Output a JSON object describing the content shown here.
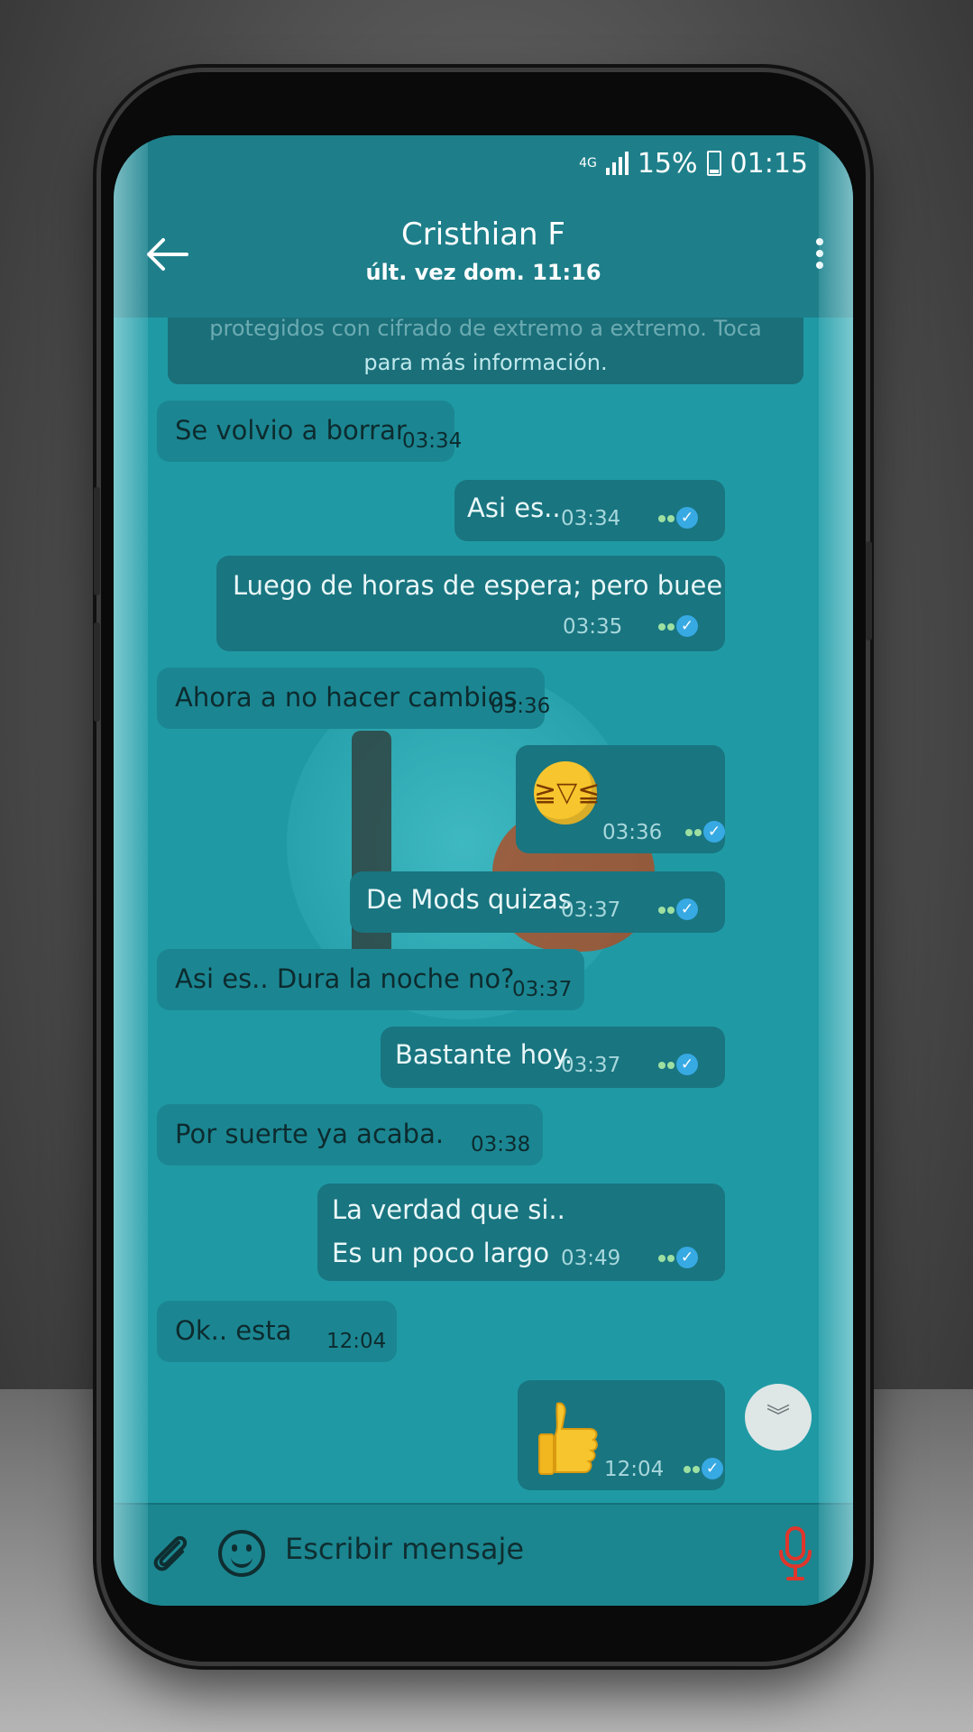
{
  "status_bar": {
    "network": "4G",
    "battery": "15%",
    "time": "01:15"
  },
  "header": {
    "contact_name": "Cristhian F",
    "last_seen": "últ. vez dom. 11:16"
  },
  "encryption_notice": {
    "line1": "protegidos con cifrado de extremo a extremo. Toca",
    "line2": "para más información."
  },
  "messages": [
    {
      "direction": "in",
      "text": "Se volvio a borrar",
      "time": "03:34"
    },
    {
      "direction": "out",
      "text": "Asi es..",
      "time": "03:34"
    },
    {
      "direction": "out",
      "text": "Luego de horas de espera; pero buee",
      "time": "03:35"
    },
    {
      "direction": "in",
      "text": "Ahora a no hacer cambios",
      "time": "03:36"
    },
    {
      "direction": "out",
      "text": "🤣",
      "time": "03:36"
    },
    {
      "direction": "out",
      "text": "De Mods  quizas",
      "time": "03:37"
    },
    {
      "direction": "in",
      "text": "Asi es..  Dura la noche no?",
      "time": "03:37"
    },
    {
      "direction": "out",
      "text": "Bastante hoy.",
      "time": "03:37"
    },
    {
      "direction": "in",
      "text": "Por suerte ya acaba.",
      "time": "03:38"
    },
    {
      "direction": "out",
      "text": "La verdad que si..",
      "text2": "Es un poco largo",
      "time": "03:49"
    },
    {
      "direction": "in",
      "text": "Ok.. esta",
      "time": "12:04"
    },
    {
      "direction": "out",
      "text": "👍",
      "time": "12:04"
    }
  ],
  "input": {
    "placeholder": "Escribir mensaje"
  },
  "colors": {
    "header": "#1e7f8a",
    "background": "#1f9aa5",
    "read_tick": "#37a9e3",
    "mic": "#e0352b"
  }
}
